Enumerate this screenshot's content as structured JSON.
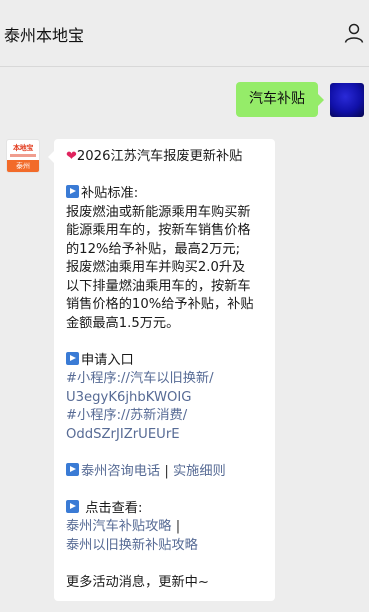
{
  "header": {
    "title": "泰州本地宝",
    "user_icon": "person-icon"
  },
  "sent": {
    "text": "汽车补贴",
    "color": "#95ec69"
  },
  "bot": {
    "avatar_brand": "本地宝",
    "avatar_city": "泰州",
    "title": "2026江苏汽车报废更新补贴",
    "subsidy_heading": "补贴标准:",
    "subsidy_lines": [
      "报废燃油或新能源乘用车购买新",
      "能源乘用车的，按新车销售价格",
      "的12%给予补贴，最高2万元;",
      "报废燃油乘用车并购买2.0升及",
      "以下排量燃油乘用车的，按新车",
      "销售价格的10%给予补贴，补贴",
      "金额最高1.5万元。"
    ],
    "apply_heading": "申请入口",
    "apply_links": [
      "#小程序://汽车以旧换新/",
      "U3egyK6jhbKWOIG",
      "#小程序://苏新消费/",
      "OddSZrJIZrUEUrE"
    ],
    "consult_link": "泰州咨询电话",
    "consult_sep": "|",
    "detail_link": "实施细则",
    "view_heading": "点击查看:",
    "view_link_1": "泰州汽车补贴攻略",
    "view_sep": "|",
    "view_link_2": "泰州以旧换新补贴攻略",
    "footer": "更多活动消息，更新中~"
  }
}
